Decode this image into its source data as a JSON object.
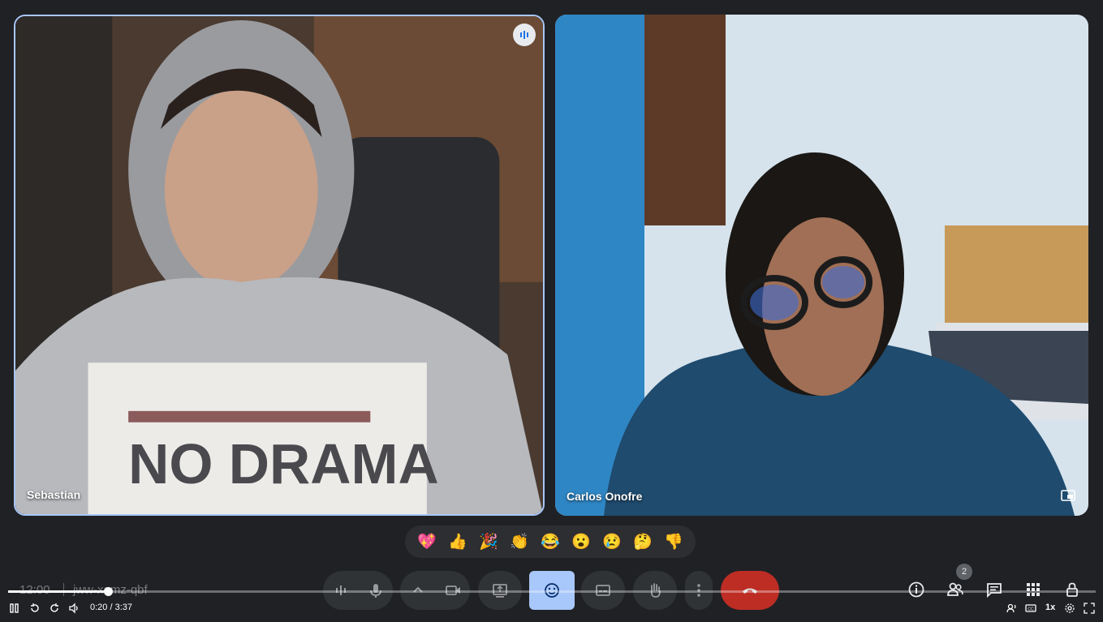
{
  "meeting": {
    "time": "12:00",
    "code": "jww-xqmz-qbf"
  },
  "participants": [
    {
      "name": "Sebastian",
      "speaking": true
    },
    {
      "name": "Carlos Onofre",
      "speaking": false
    }
  ],
  "reactions": [
    "💖",
    "👍",
    "🎉",
    "👏",
    "😂",
    "😮",
    "😢",
    "🤔",
    "👎"
  ],
  "controls": {
    "people_count": "2",
    "accent_end_call": "#d93025",
    "accent_active": "#a8c7fa"
  },
  "player": {
    "time": "0:20 / 3:37",
    "progress": 0.092,
    "speed": "1x"
  }
}
